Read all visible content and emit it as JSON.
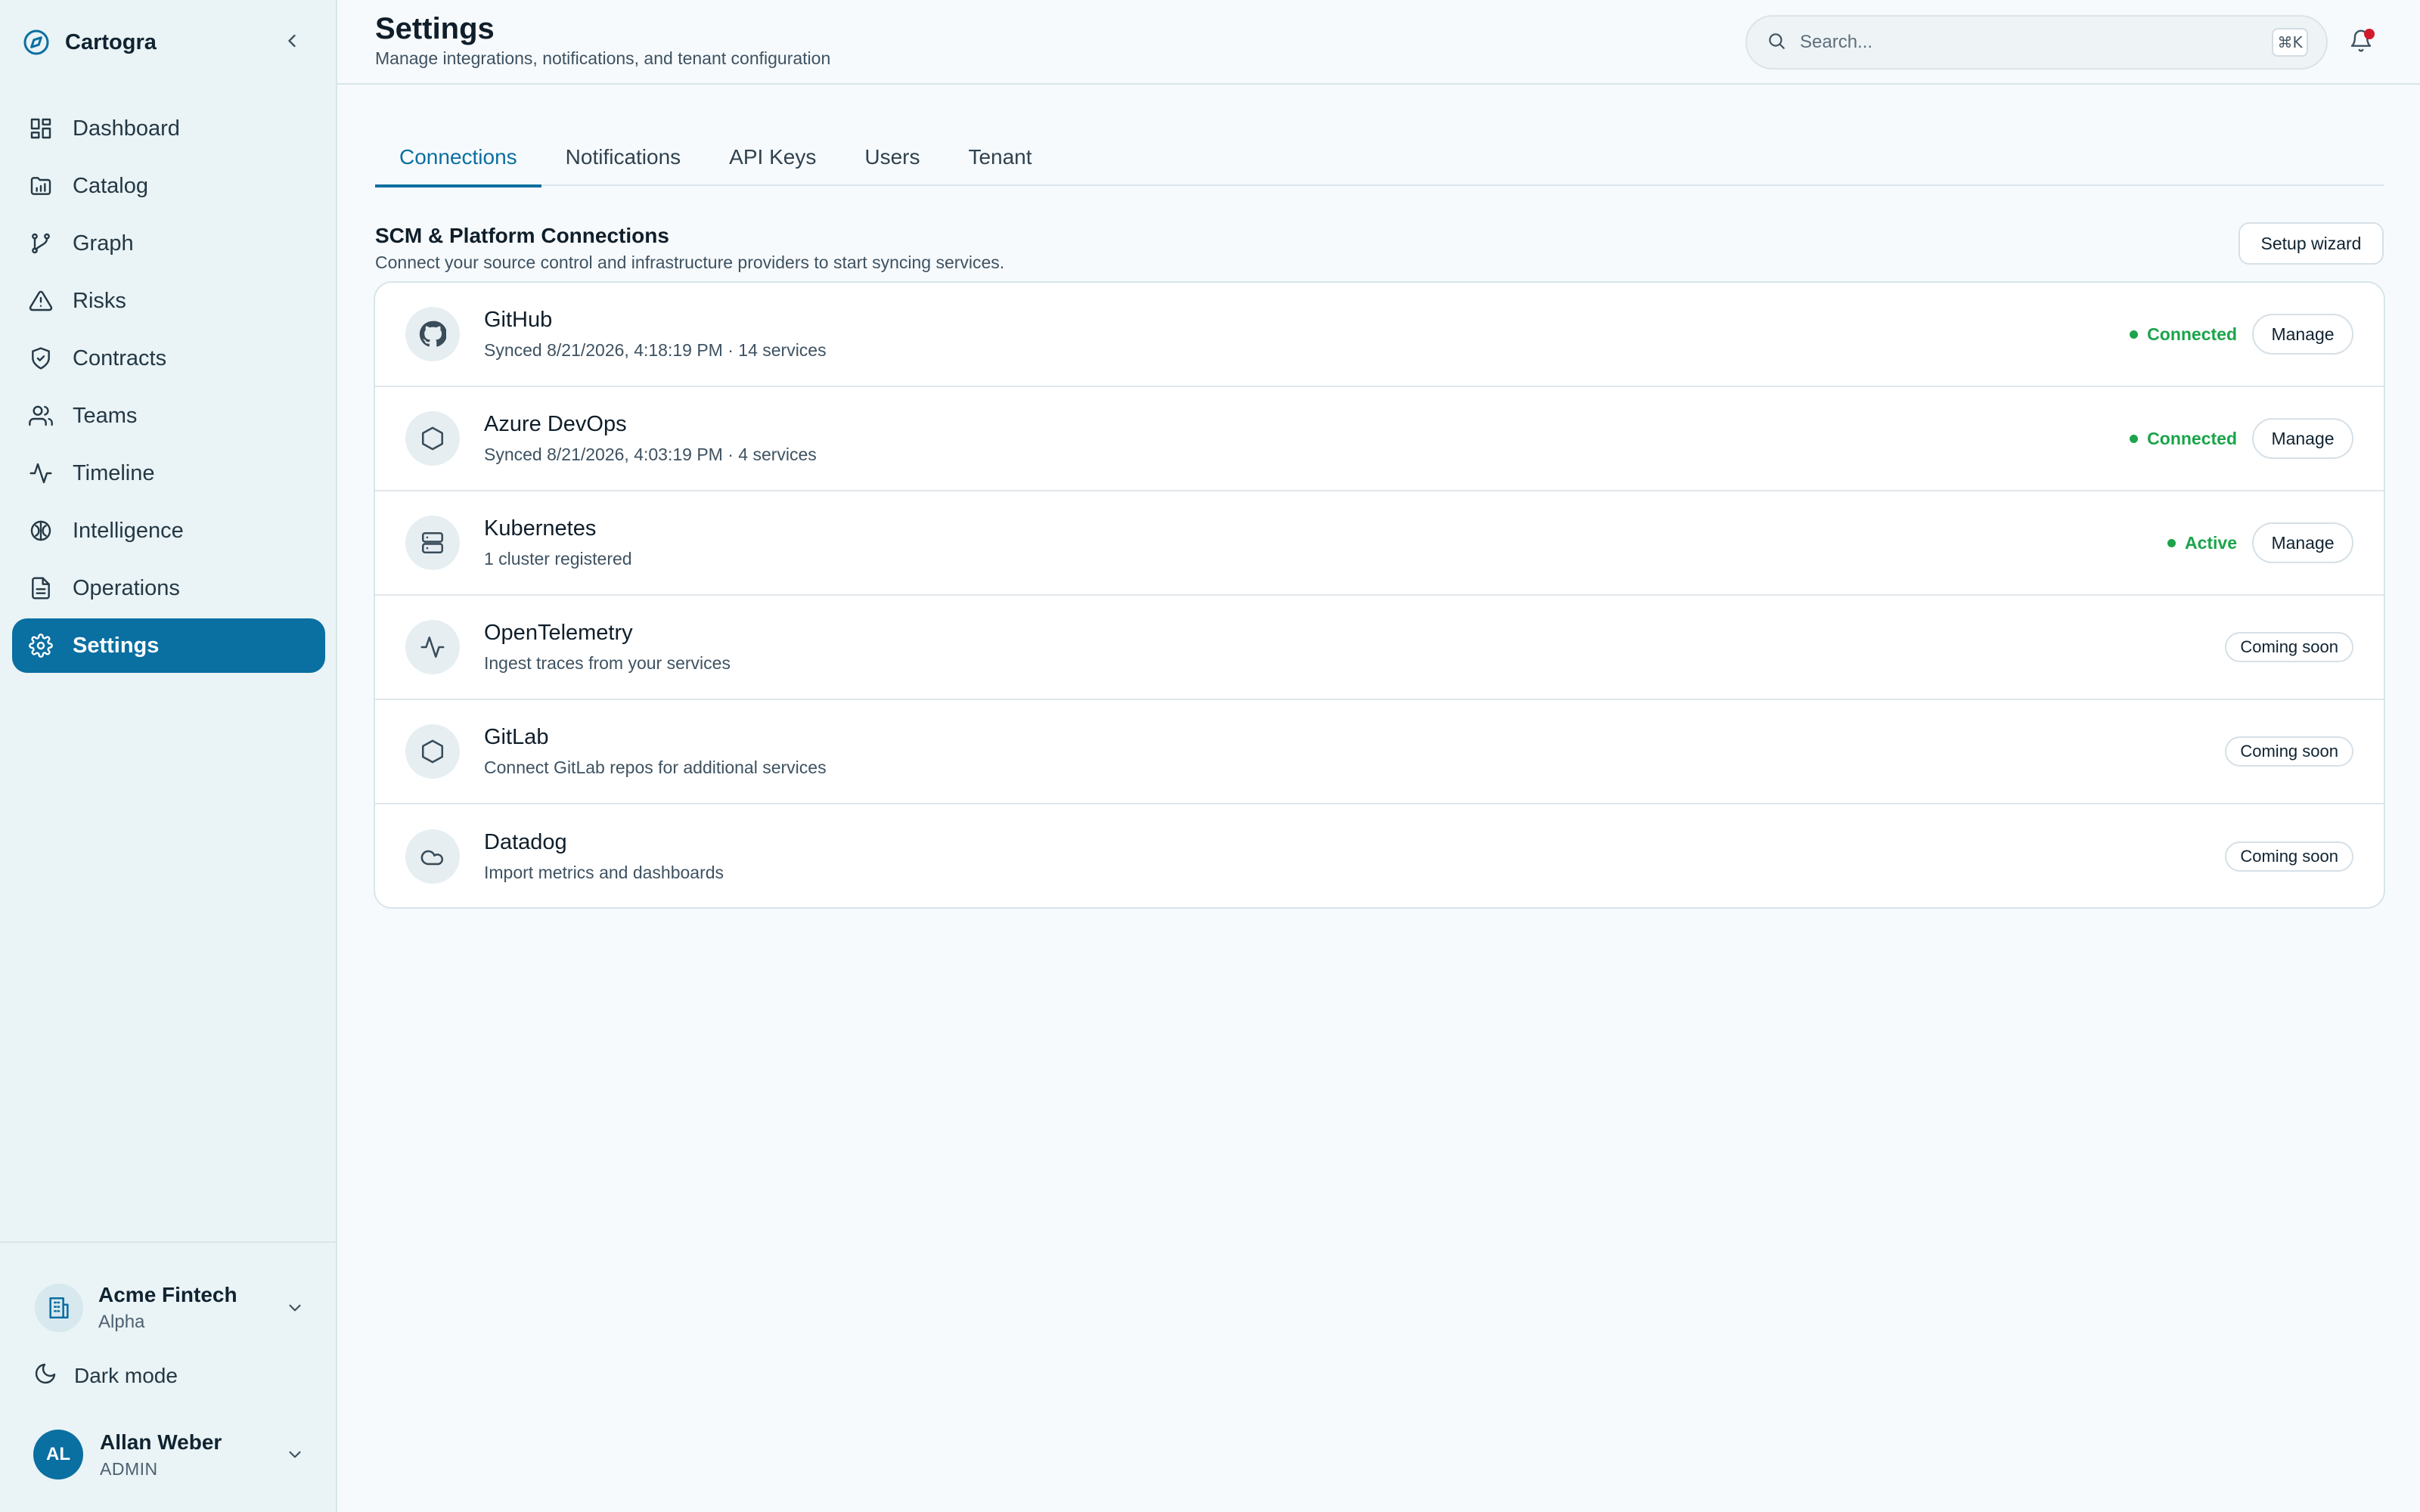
{
  "app": {
    "name": "Cartogra"
  },
  "sidebar": {
    "items": [
      {
        "label": "Dashboard",
        "icon": "dashboard-icon"
      },
      {
        "label": "Catalog",
        "icon": "folder-icon"
      },
      {
        "label": "Graph",
        "icon": "graph-icon"
      },
      {
        "label": "Risks",
        "icon": "warning-icon"
      },
      {
        "label": "Contracts",
        "icon": "shield-icon"
      },
      {
        "label": "Teams",
        "icon": "users-icon"
      },
      {
        "label": "Timeline",
        "icon": "activity-icon"
      },
      {
        "label": "Intelligence",
        "icon": "brain-icon"
      },
      {
        "label": "Operations",
        "icon": "document-icon"
      },
      {
        "label": "Settings",
        "icon": "gear-icon",
        "active": true
      }
    ],
    "tenant": {
      "name": "Acme Fintech",
      "sub": "Alpha"
    },
    "dark_mode_label": "Dark mode",
    "user": {
      "initials": "AL",
      "name": "Allan Weber",
      "role": "ADMIN"
    }
  },
  "header": {
    "title": "Settings",
    "subtitle": "Manage integrations, notifications, and tenant configuration",
    "search_placeholder": "Search...",
    "search_shortcut": "⌘K"
  },
  "tabs": [
    {
      "label": "Connections",
      "active": true
    },
    {
      "label": "Notifications"
    },
    {
      "label": "API Keys"
    },
    {
      "label": "Users"
    },
    {
      "label": "Tenant"
    }
  ],
  "section": {
    "title": "SCM & Platform Connections",
    "subtitle": "Connect your source control and infrastructure providers to start syncing services.",
    "setup_label": "Setup wizard"
  },
  "connections": [
    {
      "name": "GitHub",
      "desc": "Synced 8/21/2026, 4:18:19 PM · 14 services",
      "status": "Connected",
      "action": "Manage",
      "icon": "github-icon"
    },
    {
      "name": "Azure DevOps",
      "desc": "Synced 8/21/2026, 4:03:19 PM · 4 services",
      "status": "Connected",
      "action": "Manage",
      "icon": "hexagon-icon"
    },
    {
      "name": "Kubernetes",
      "desc": "1 cluster registered",
      "status": "Active",
      "action": "Manage",
      "icon": "server-icon"
    },
    {
      "name": "OpenTelemetry",
      "desc": "Ingest traces from your services",
      "badge": "Coming soon",
      "icon": "activity-icon"
    },
    {
      "name": "GitLab",
      "desc": "Connect GitLab repos for additional services",
      "badge": "Coming soon",
      "icon": "hexagon-icon"
    },
    {
      "name": "Datadog",
      "desc": "Import metrics and dashboards",
      "badge": "Coming soon",
      "icon": "cloud-icon"
    }
  ],
  "colors": {
    "accent": "#0a6fa1",
    "success": "#1ba44a",
    "notification": "#d11a2a"
  }
}
